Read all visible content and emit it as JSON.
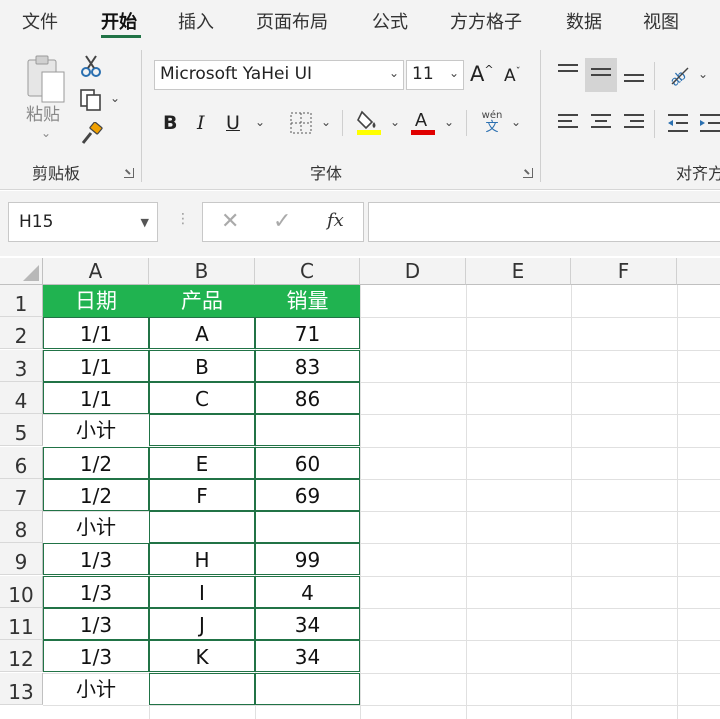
{
  "ribbon_tabs": [
    "文件",
    "开始",
    "插入",
    "页面布局",
    "公式",
    "方方格子",
    "数据",
    "视图"
  ],
  "active_tab": "开始",
  "clipboard": {
    "paste_label": "粘贴",
    "group_label": "剪贴板"
  },
  "font": {
    "name": "Microsoft YaHei UI",
    "size": "11",
    "grow": "A",
    "shrink": "A",
    "bold": "B",
    "italic": "I",
    "underline": "U",
    "group_label": "字体",
    "wen_top": "wén",
    "wen_bottom": "文"
  },
  "alignment": {
    "group_label": "对齐方"
  },
  "formula_bar": {
    "cell_ref": "H15",
    "fx_label": "fx",
    "formula": ""
  },
  "columns": [
    "A",
    "B",
    "C",
    "D",
    "E",
    "F"
  ],
  "rows": [
    "1",
    "2",
    "3",
    "4",
    "5",
    "6",
    "7",
    "8",
    "9",
    "10",
    "11",
    "12",
    "13"
  ],
  "table": {
    "headers": [
      "日期",
      "产品",
      "销量"
    ],
    "rows": [
      [
        "1/1",
        "A",
        "71"
      ],
      [
        "1/1",
        "B",
        "83"
      ],
      [
        "1/1",
        "C",
        "86"
      ],
      [
        "小计",
        "",
        ""
      ],
      [
        "1/2",
        "E",
        "60"
      ],
      [
        "1/2",
        "F",
        "69"
      ],
      [
        "小计",
        "",
        ""
      ],
      [
        "1/3",
        "H",
        "99"
      ],
      [
        "1/3",
        "I",
        "4"
      ],
      [
        "1/3",
        "J",
        "34"
      ],
      [
        "1/3",
        "K",
        "34"
      ],
      [
        "小计",
        "",
        ""
      ]
    ]
  },
  "colors": {
    "accent": "#217346",
    "header_fill": "#20b350",
    "font_color_bar": "#e00000",
    "highlight_bar": "#ffff00"
  }
}
